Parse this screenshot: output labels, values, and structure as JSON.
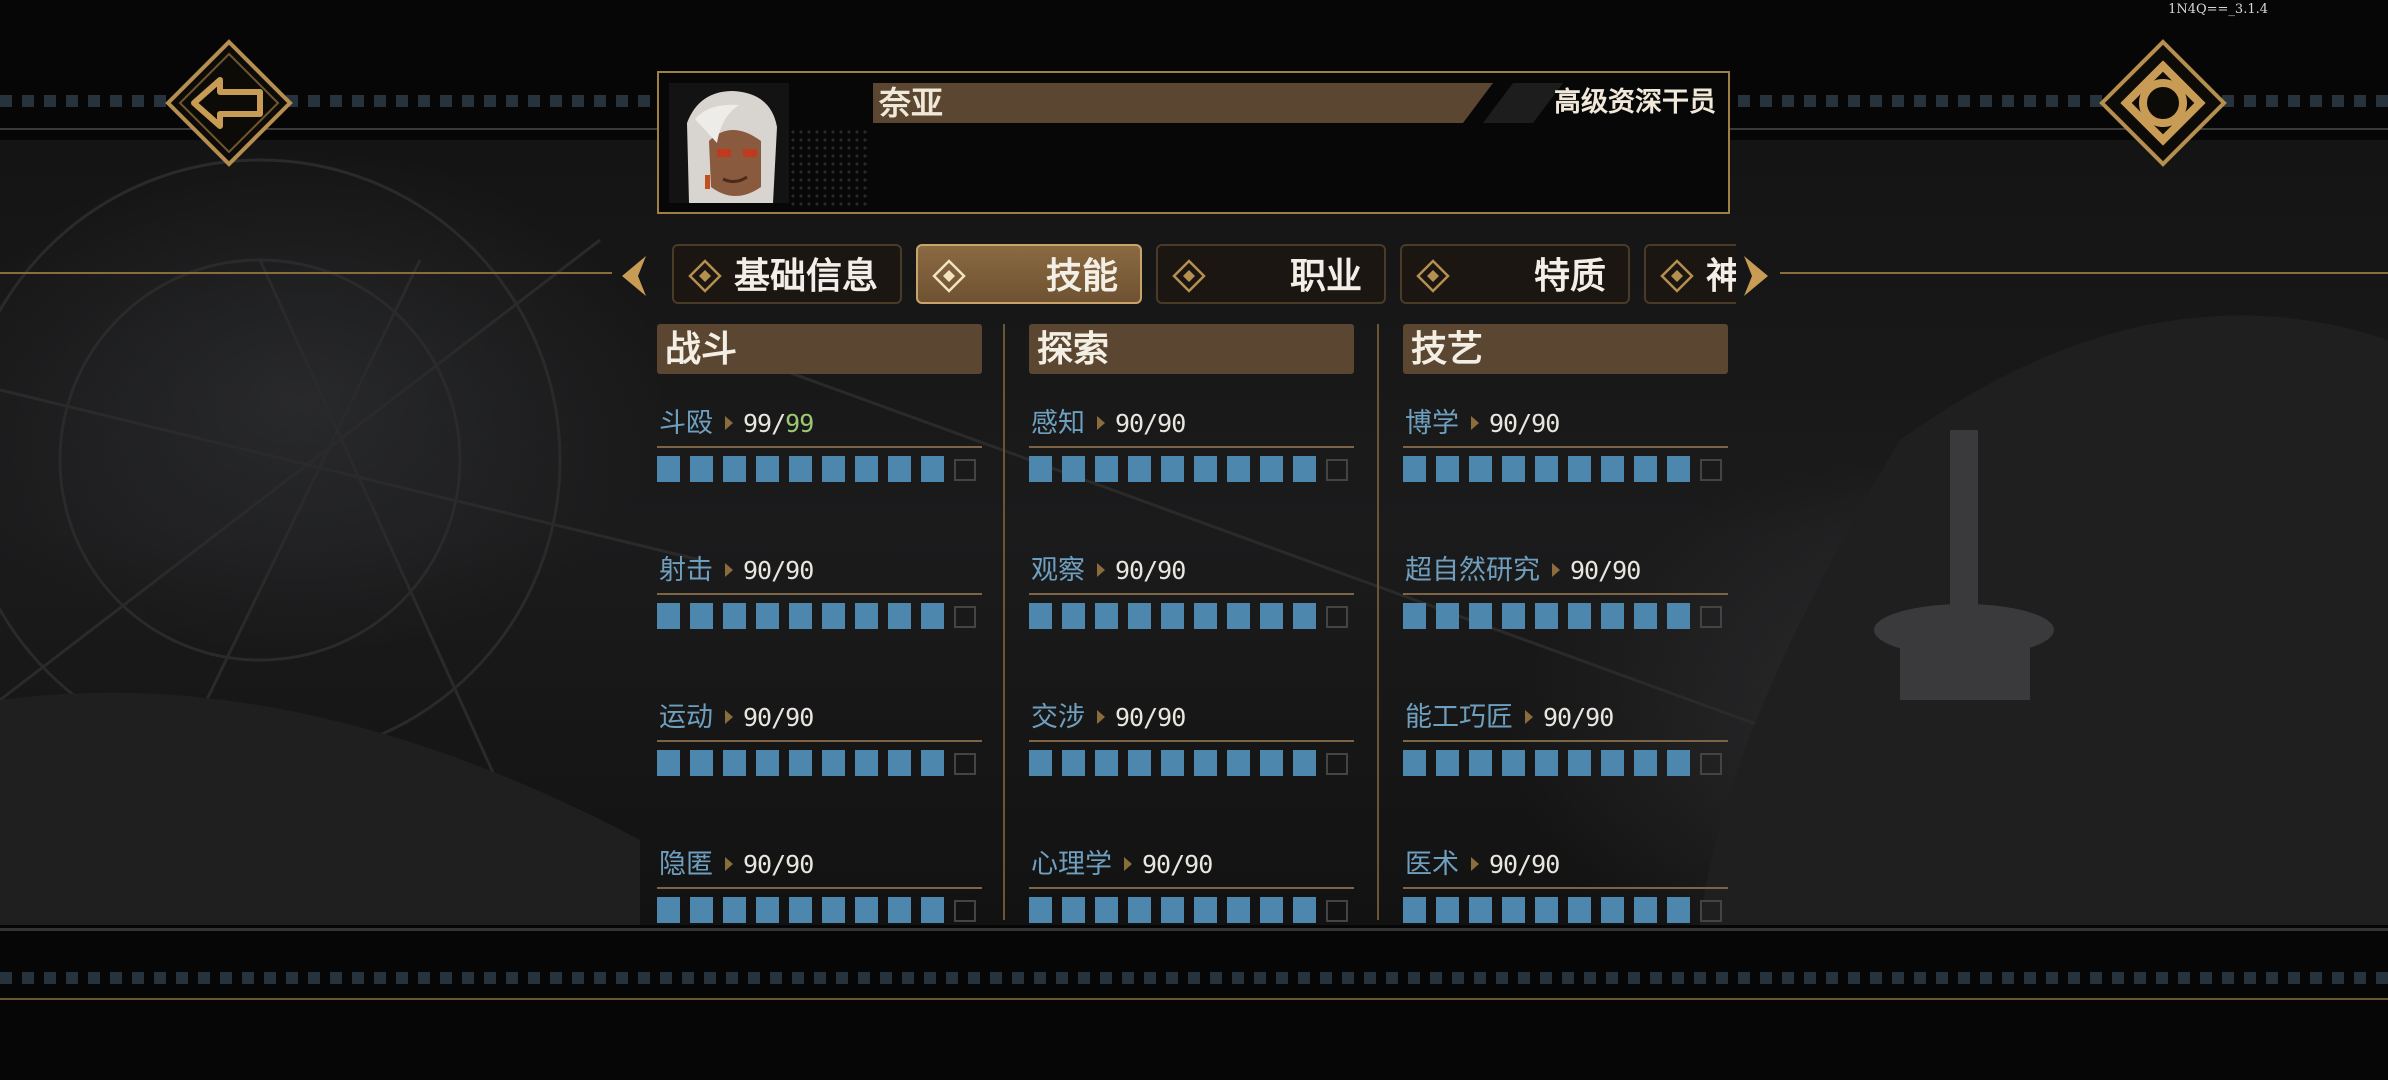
{
  "version": "1N4Q==_3.1.4",
  "character": {
    "name": "奈亚",
    "title": "高级资深干员"
  },
  "tabs": [
    {
      "label": "基础信息",
      "active": false
    },
    {
      "label": "技能",
      "active": true
    },
    {
      "label": "职业",
      "active": false
    },
    {
      "label": "特质",
      "active": false
    },
    {
      "label": "神",
      "active": false
    }
  ],
  "columns": [
    {
      "header": "战斗",
      "skills": [
        {
          "name": "斗殴",
          "current": "99",
          "max": "99",
          "filled": 9,
          "total": 10
        },
        {
          "name": "射击",
          "current": "90",
          "max": "90",
          "filled": 9,
          "total": 10
        },
        {
          "name": "运动",
          "current": "90",
          "max": "90",
          "filled": 9,
          "total": 10
        },
        {
          "name": "隐匿",
          "current": "90",
          "max": "90",
          "filled": 9,
          "total": 10
        }
      ]
    },
    {
      "header": "探索",
      "skills": [
        {
          "name": "感知",
          "current": "90",
          "max": "90",
          "filled": 9,
          "total": 10
        },
        {
          "name": "观察",
          "current": "90",
          "max": "90",
          "filled": 9,
          "total": 10
        },
        {
          "name": "交涉",
          "current": "90",
          "max": "90",
          "filled": 9,
          "total": 10
        },
        {
          "name": "心理学",
          "current": "90",
          "max": "90",
          "filled": 9,
          "total": 10
        }
      ]
    },
    {
      "header": "技艺",
      "skills": [
        {
          "name": "博学",
          "current": "90",
          "max": "90",
          "filled": 9,
          "total": 10
        },
        {
          "name": "超自然研究",
          "current": "90",
          "max": "90",
          "filled": 9,
          "total": 10
        },
        {
          "name": "能工巧匠",
          "current": "90",
          "max": "90",
          "filled": 9,
          "total": 10
        },
        {
          "name": "医术",
          "current": "90",
          "max": "90",
          "filled": 9,
          "total": 10
        }
      ]
    }
  ],
  "colors": {
    "gold": "#a07f45",
    "skill_blue": "#4d87ad",
    "label_blue": "#6f9fbf",
    "highlight_green": "#9bc872",
    "tab_active": "#7a5c38"
  },
  "icons": {
    "back": "back-arrow-icon",
    "settings": "gear-icon"
  }
}
